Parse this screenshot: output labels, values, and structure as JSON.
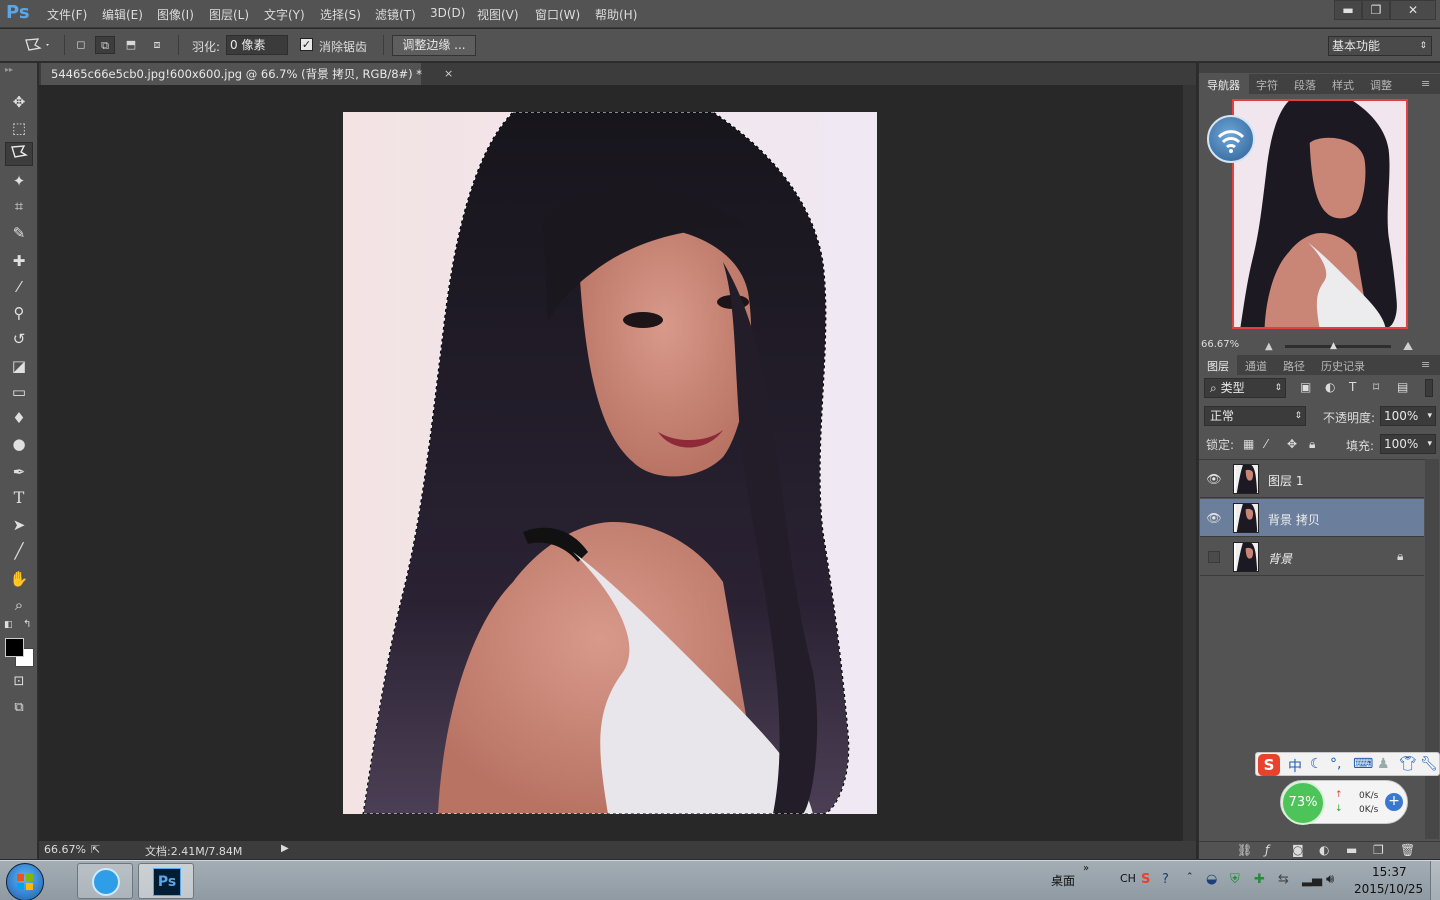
{
  "app": {
    "logo": "Ps",
    "menu": [
      "文件(F)",
      "编辑(E)",
      "图像(I)",
      "图层(L)",
      "文字(Y)",
      "选择(S)",
      "滤镜(T)",
      "3D(D)",
      "视图(V)",
      "窗口(W)",
      "帮助(H)"
    ],
    "window_buttons": {
      "minimize": "▬",
      "restore": "❐",
      "close": "✕"
    }
  },
  "options_bar": {
    "feather_label": "羽化:",
    "feather_value": "0 像素",
    "antialias_label": "消除锯齿",
    "antialias_checked": true,
    "refine_edge_label": "调整边缘 ...",
    "workspace": "基本功能"
  },
  "tools": [
    "move-tool",
    "marquee-tool",
    "polygonal-lasso-tool",
    "magic-wand-tool",
    "crop-tool",
    "eyedropper-tool",
    "healing-brush-tool",
    "brush-tool",
    "clone-stamp-tool",
    "history-brush-tool",
    "eraser-tool",
    "gradient-tool",
    "blur-tool",
    "dodge-tool",
    "pen-tool",
    "type-tool",
    "path-selection-tool",
    "line-tool",
    "hand-tool",
    "zoom-tool"
  ],
  "type_tool_glyph": "T",
  "document": {
    "tab_title": "54465c66e5cb0.jpg!600x600.jpg @ 66.7% (背景 拷贝, RGB/8#) *",
    "tab_close": "×",
    "zoom": "66.67%",
    "doc_info": "文档:2.41M/7.84M"
  },
  "navigator": {
    "tabs": [
      "导航器",
      "字符",
      "段落",
      "样式",
      "调整"
    ],
    "zoom": "66.67%"
  },
  "layers_panel": {
    "tabs": [
      "图层",
      "通道",
      "路径",
      "历史记录"
    ],
    "filter_kind": "类型",
    "blend_mode": "正常",
    "opacity_label": "不透明度:",
    "opacity_value": "100%",
    "lock_label": "锁定:",
    "fill_label": "填充:",
    "fill_value": "100%",
    "layers": [
      {
        "name": "图层 1",
        "visible": true,
        "selected": false,
        "locked": false
      },
      {
        "name": "背景 拷贝",
        "visible": true,
        "selected": true,
        "locked": false
      },
      {
        "name": "背景",
        "visible": false,
        "selected": false,
        "locked": true
      }
    ]
  },
  "ime": {
    "zh": "中"
  },
  "net_speed": {
    "percent": "73%",
    "up": "0K/s",
    "down": "0K/s"
  },
  "taskbar": {
    "desktop_label": "桌面",
    "lang": "CH",
    "time": "15:37",
    "date": "2015/10/25"
  },
  "colors": {
    "panel_bg": "#535353",
    "canvas_bg": "#282828",
    "selected_layer": "#6b7f9c",
    "nav_frame": "#e04040",
    "speed_green": "#4cc45a"
  }
}
